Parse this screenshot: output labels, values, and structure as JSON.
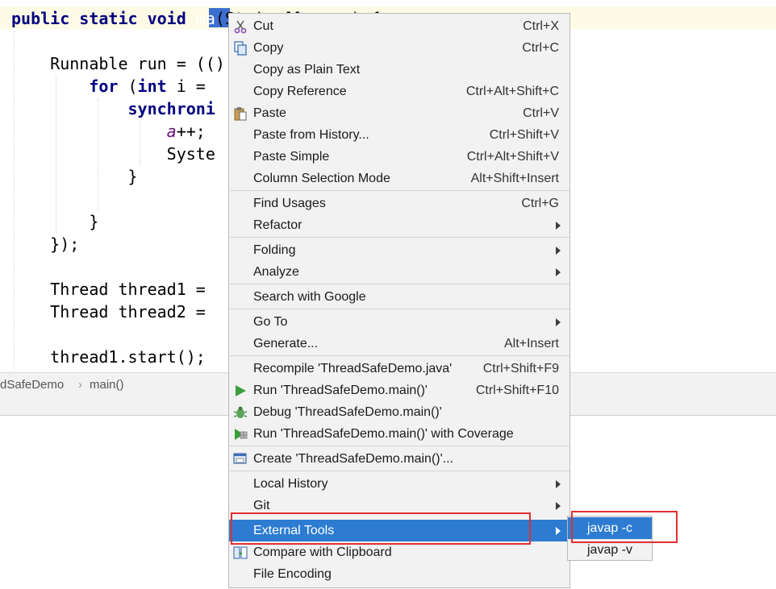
{
  "editor": {
    "selected_word": "ma",
    "lines": {
      "l1a": "public static void ",
      "l1c": "(String[] args) {",
      "l3": "    Runnable run = (()",
      "l4a": "        ",
      "l4b": "for",
      "l4c": " (",
      "l4d": "int",
      "l4e": " i = ",
      "l5": "synchroni",
      "l6a": "a",
      "l6b": "++;",
      "l7": "Syste",
      "l8": "            }",
      "l10": "        }",
      "l11": "    });",
      "l13": "    Thread thread1 = ",
      "l14": "    Thread thread2 = ",
      "l16": "    thread1.start();"
    }
  },
  "breadcrumb": {
    "item1": "dSafeDemo",
    "sep": "›",
    "item2": "main()"
  },
  "context_menu": {
    "items": [
      {
        "label": "Cut",
        "shortcut": "Ctrl+X",
        "icon": "scissors-icon"
      },
      {
        "label": "Copy",
        "shortcut": "Ctrl+C",
        "icon": "copy-icon"
      },
      {
        "label": "Copy as Plain Text",
        "shortcut": ""
      },
      {
        "label": "Copy Reference",
        "shortcut": "Ctrl+Alt+Shift+C"
      },
      {
        "label": "Paste",
        "shortcut": "Ctrl+V",
        "icon": "paste-icon"
      },
      {
        "label": "Paste from History...",
        "shortcut": "Ctrl+Shift+V"
      },
      {
        "label": "Paste Simple",
        "shortcut": "Ctrl+Alt+Shift+V"
      },
      {
        "label": "Column Selection Mode",
        "shortcut": "Alt+Shift+Insert"
      },
      {
        "label": "Find Usages",
        "shortcut": "Ctrl+G"
      },
      {
        "label": "Refactor",
        "submenu": true
      },
      {
        "label": "Folding",
        "submenu": true
      },
      {
        "label": "Analyze",
        "submenu": true
      },
      {
        "label": "Search with Google",
        "shortcut": ""
      },
      {
        "label": "Go To",
        "submenu": true
      },
      {
        "label": "Generate...",
        "shortcut": "Alt+Insert"
      },
      {
        "label": "Recompile 'ThreadSafeDemo.java'",
        "shortcut": "Ctrl+Shift+F9"
      },
      {
        "label": "Run 'ThreadSafeDemo.main()'",
        "shortcut": "Ctrl+Shift+F10",
        "icon": "run-icon"
      },
      {
        "label": "Debug 'ThreadSafeDemo.main()'",
        "shortcut": "",
        "icon": "debug-icon"
      },
      {
        "label": "Run 'ThreadSafeDemo.main()' with Coverage",
        "shortcut": "",
        "icon": "coverage-icon"
      },
      {
        "label": "Create 'ThreadSafeDemo.main()'...",
        "shortcut": "",
        "icon": "create-config-icon"
      },
      {
        "label": "Local History",
        "submenu": true
      },
      {
        "label": "Git",
        "submenu": true
      },
      {
        "label": "External Tools",
        "submenu": true,
        "active": true
      },
      {
        "label": "Compare with Clipboard",
        "shortcut": "",
        "icon": "compare-icon"
      },
      {
        "label": "File Encoding",
        "shortcut": ""
      }
    ]
  },
  "submenu": {
    "items": [
      {
        "label": "javap -c",
        "active": true
      },
      {
        "label": "javap -v"
      }
    ]
  },
  "colors": {
    "accent": "#2d7cd2",
    "highlight_box": "#e03030",
    "keyword": "#000080",
    "field": "#660e7a"
  }
}
